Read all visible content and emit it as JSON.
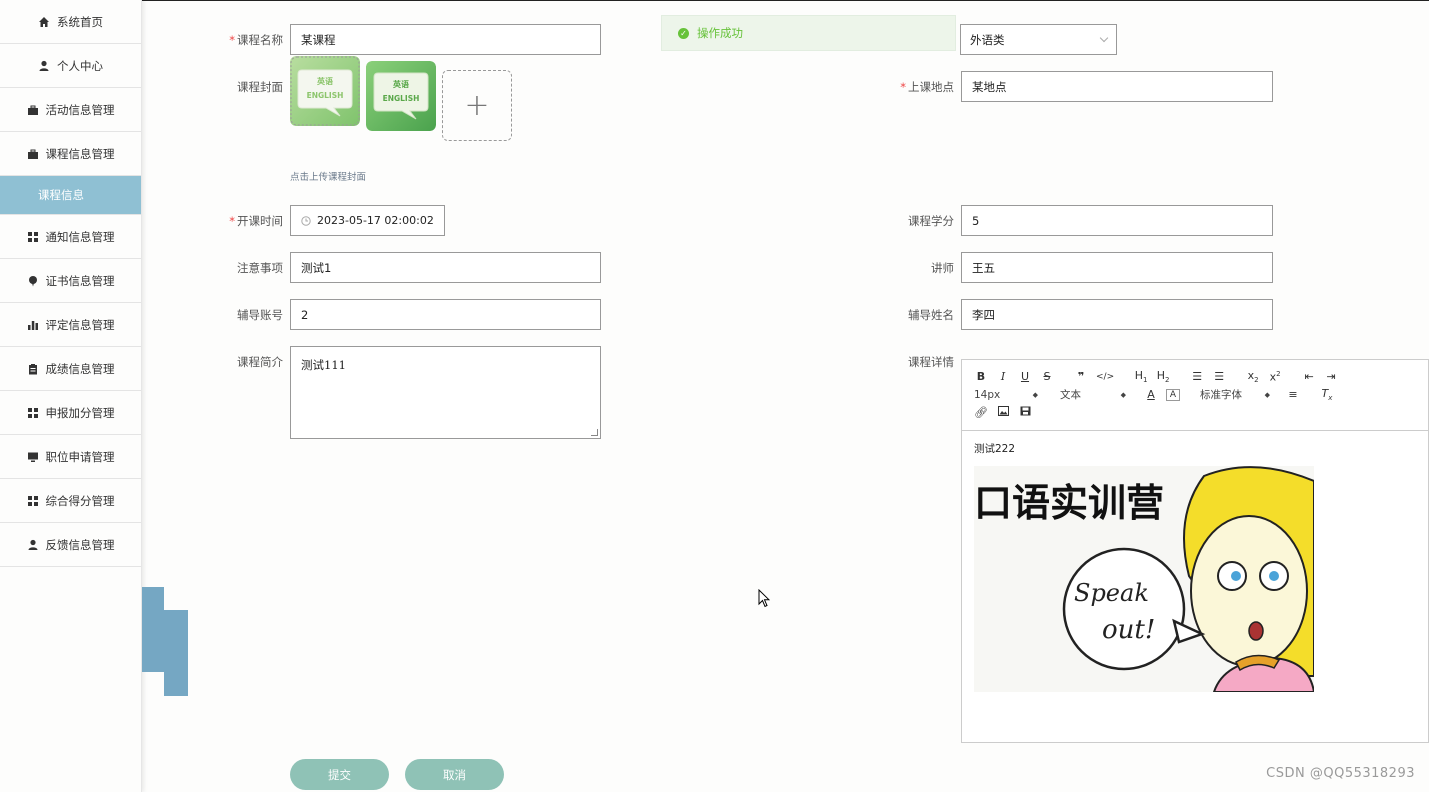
{
  "sidebar": {
    "items": [
      {
        "label": "系统首页",
        "icon": "home-icon"
      },
      {
        "label": "个人中心",
        "icon": "user-icon"
      },
      {
        "label": "活动信息管理",
        "icon": "briefcase-icon"
      },
      {
        "label": "课程信息管理",
        "icon": "briefcase-icon"
      },
      {
        "label": "课程信息",
        "icon": ""
      },
      {
        "label": "通知信息管理",
        "icon": "grid-icon"
      },
      {
        "label": "证书信息管理",
        "icon": "pin-icon"
      },
      {
        "label": "评定信息管理",
        "icon": "bar-chart-icon"
      },
      {
        "label": "成绩信息管理",
        "icon": "clipboard-icon"
      },
      {
        "label": "申报加分管理",
        "icon": "grid-icon"
      },
      {
        "label": "职位申请管理",
        "icon": "monitor-icon"
      },
      {
        "label": "综合得分管理",
        "icon": "grid-icon"
      },
      {
        "label": "反馈信息管理",
        "icon": "user-icon"
      }
    ]
  },
  "toast": {
    "message": "操作成功"
  },
  "form": {
    "course_name": {
      "label": "课程名称",
      "value": "某课程"
    },
    "category": {
      "value": "外语类"
    },
    "cover": {
      "label": "课程封面",
      "hint": "点击上传课程封面",
      "image_text_top": "英语",
      "image_text_bottom": "ENGLISH"
    },
    "location": {
      "label": "上课地点",
      "value": "某地点"
    },
    "start_time": {
      "label": "开课时间",
      "value": "2023-05-17 02:00:02"
    },
    "credits": {
      "label": "课程学分",
      "value": "5"
    },
    "notes": {
      "label": "注意事项",
      "value": "测试1"
    },
    "lecturer": {
      "label": "讲师",
      "value": "王五"
    },
    "tutor_account": {
      "label": "辅导账号",
      "value": "2"
    },
    "tutor_name": {
      "label": "辅导姓名",
      "value": "李四"
    },
    "intro": {
      "label": "课程简介",
      "value": "测试111"
    },
    "details": {
      "label": "课程详情"
    }
  },
  "editor": {
    "font_size": "14px",
    "text_type": "文本",
    "font_family": "标准字体",
    "content_text": "测试222",
    "image_title": "口语实训营",
    "image_bubble_1": "Speak",
    "image_bubble_2": "out!"
  },
  "actions": {
    "submit": "提交",
    "cancel": "取消"
  },
  "watermark": "CSDN @QQ55318293",
  "colors": {
    "sidebar_active": "#8fc0d3",
    "button": "#8fc2b6",
    "success": "#67c23a"
  }
}
